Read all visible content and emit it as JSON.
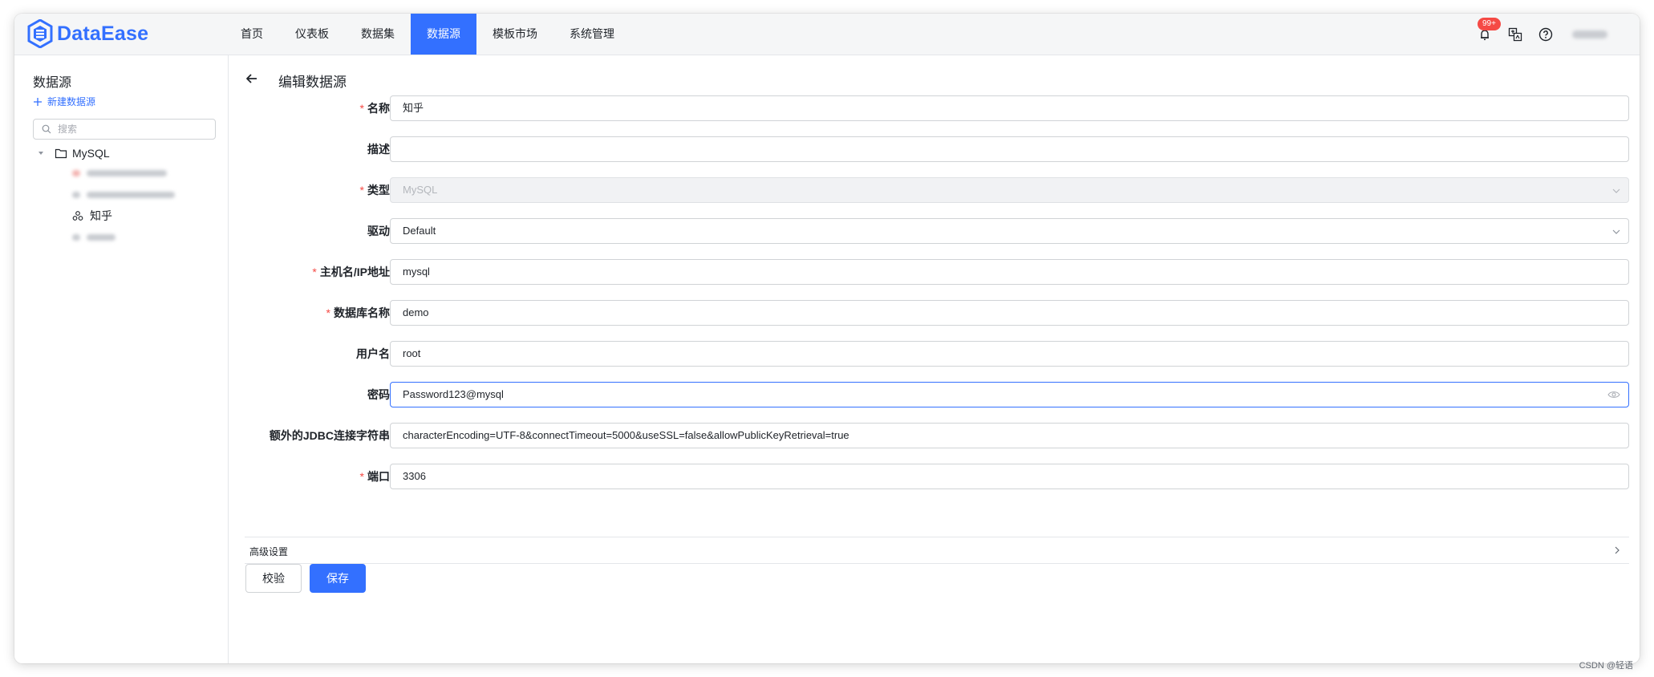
{
  "app": {
    "name": "DataEase"
  },
  "colors": {
    "accent": "#3370ff",
    "required": "#f54a45",
    "badge": "#f54a45"
  },
  "nav": {
    "items": [
      {
        "label": "首页",
        "active": false
      },
      {
        "label": "仪表板",
        "active": false
      },
      {
        "label": "数据集",
        "active": false
      },
      {
        "label": "数据源",
        "active": true
      },
      {
        "label": "模板市场",
        "active": false
      },
      {
        "label": "系统管理",
        "active": false
      }
    ],
    "notification_badge": "99+",
    "icons": [
      "bell-icon",
      "translate-icon",
      "help-icon"
    ]
  },
  "sidebar": {
    "title": "数据源",
    "new_label": "新建数据源",
    "search_placeholder": "搜索",
    "tree": {
      "root": "MySQL",
      "selected_child": "知乎"
    }
  },
  "page": {
    "title": "编辑数据源"
  },
  "form": {
    "name": {
      "label": "名称",
      "required": true,
      "value": "知乎"
    },
    "desc": {
      "label": "描述",
      "required": false,
      "value": ""
    },
    "type": {
      "label": "类型",
      "required": true,
      "value": "MySQL"
    },
    "driver": {
      "label": "驱动",
      "required": false,
      "value": "Default"
    },
    "host": {
      "label": "主机名/IP地址",
      "required": true,
      "value": "mysql"
    },
    "db": {
      "label": "数据库名称",
      "required": true,
      "value": "demo"
    },
    "user": {
      "label": "用户名",
      "required": false,
      "value": "root"
    },
    "password": {
      "label": "密码",
      "required": false,
      "value": "Password123@mysql"
    },
    "jdbc": {
      "label": "额外的JDBC连接字符串",
      "required": false,
      "value": "characterEncoding=UTF-8&connectTimeout=5000&useSSL=false&allowPublicKeyRetrieval=true"
    },
    "port": {
      "label": "端口",
      "required": true,
      "value": "3306"
    }
  },
  "advanced": {
    "label": "高级设置"
  },
  "buttons": {
    "verify": "校验",
    "save": "保存"
  },
  "watermark": "CSDN @轻语"
}
